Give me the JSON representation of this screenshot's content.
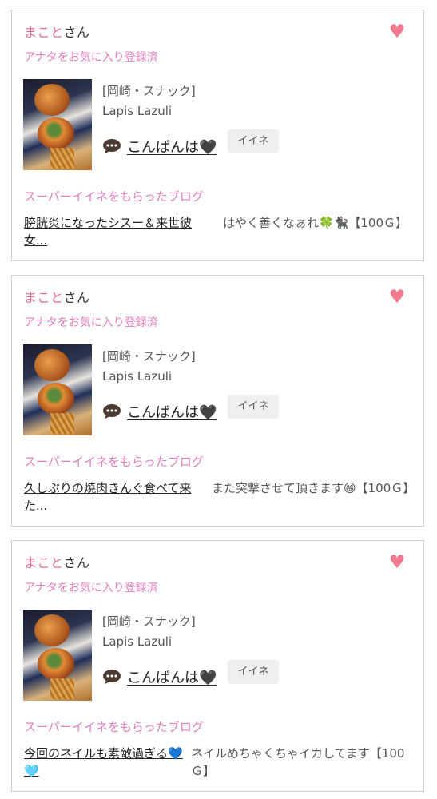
{
  "accent_color": "#e56a8e",
  "favorite_text_color": "#e37fbf",
  "cards": [
    {
      "user_name": "まこと",
      "user_suffix": "さん",
      "favorite_status": "アナタをお気に入り登録済",
      "shop_category": "[岡崎・スナック]",
      "shop_name": "Lapis Lazuli",
      "message": "こんばんは🖤",
      "like_label": "イイネ",
      "super_like_heading": "スーパーイイネをもらったブログ",
      "blog_title": "膀胱炎になったシスー＆来世彼女...",
      "blog_comment": "はやく善くなぁれ🍀🐈‍⬛【100Ｇ】"
    },
    {
      "user_name": "まこと",
      "user_suffix": "さん",
      "favorite_status": "アナタをお気に入り登録済",
      "shop_category": "[岡崎・スナック]",
      "shop_name": "Lapis Lazuli",
      "message": "こんばんは🖤",
      "like_label": "イイネ",
      "super_like_heading": "スーパーイイネをもらったブログ",
      "blog_title": "久しぶりの焼肉きんぐ食べて来た...",
      "blog_comment": "また突撃させて頂きます😁【100Ｇ】"
    },
    {
      "user_name": "まこと",
      "user_suffix": "さん",
      "favorite_status": "アナタをお気に入り登録済",
      "shop_category": "[岡崎・スナック]",
      "shop_name": "Lapis Lazuli",
      "message": "こんばんは🖤",
      "like_label": "イイネ",
      "super_like_heading": "スーパーイイネをもらったブログ",
      "blog_title": "今回のネイルも素敵過ぎる💙🩵",
      "blog_comment": "ネイルめちゃくちゃイカしてます【100Ｇ】"
    }
  ]
}
